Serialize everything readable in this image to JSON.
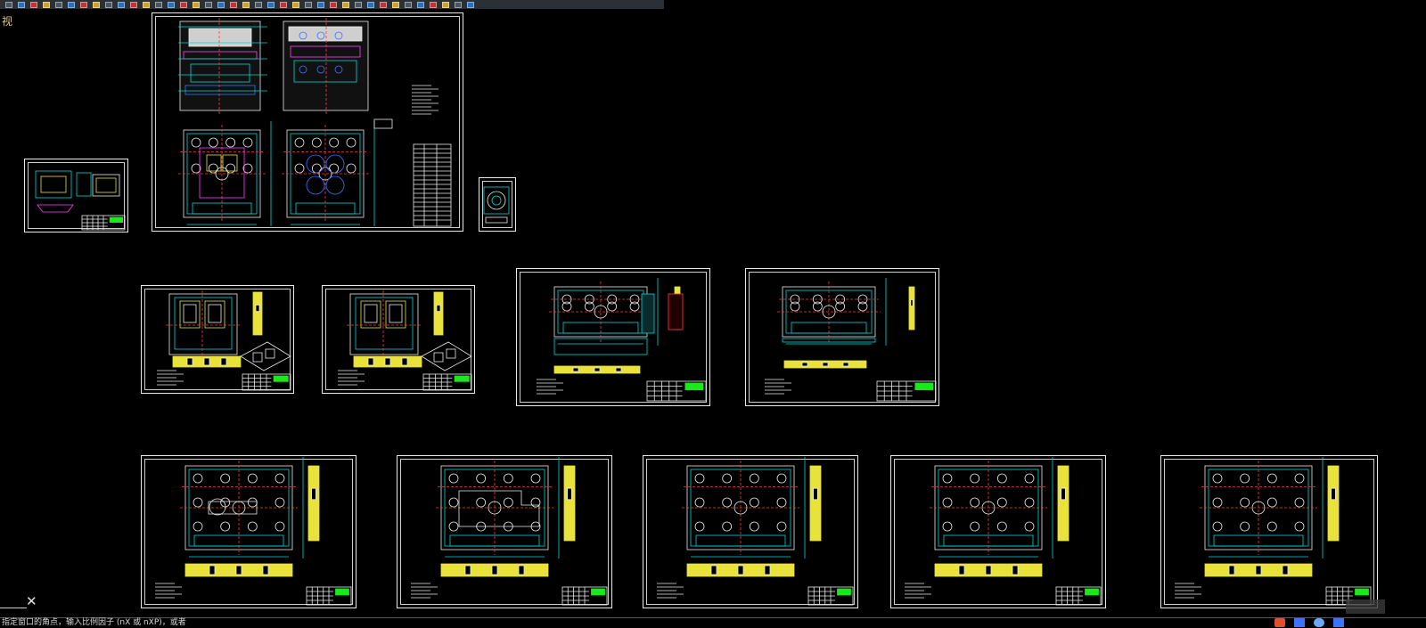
{
  "app": {
    "view_label": "视",
    "command_prompt": "指定窗口的角点，输入比例因子 (nX 或 nXP)，或者",
    "close_glyph": "✕"
  },
  "toolbar": {
    "icons": [
      "new-icon",
      "open-icon",
      "save-icon",
      "saveas-icon",
      "plot-icon",
      "undo-icon",
      "redo-icon",
      "pan-icon",
      "zoom-icon",
      "layer-icon",
      "properties-icon",
      "match-icon",
      "line-icon",
      "polyline-icon",
      "circle-icon",
      "arc-icon",
      "rectangle-icon",
      "hatch-icon",
      "text-icon",
      "dimension-icon",
      "block-icon",
      "insert-icon",
      "copy-icon",
      "move-icon",
      "rotate-icon",
      "scale-icon",
      "trim-icon",
      "extend-icon",
      "offset-icon",
      "mirror-icon",
      "array-icon",
      "fillet-icon",
      "chamfer-icon",
      "explode-icon",
      "erase-icon",
      "measure-icon",
      "layout-icon",
      "help-icon"
    ]
  },
  "colors": {
    "background": "#000000",
    "sheet_border": "#e9e9e9",
    "cyan": "#00d6d6",
    "yellow": "#e8e23a",
    "red": "#ff3b3b",
    "green": "#19e819",
    "magenta": "#ff40ff",
    "blue": "#3b73ff",
    "white": "#e9e9e9"
  },
  "drawing_sheets": [
    {
      "id": "assembly",
      "kind": "assembly"
    },
    {
      "id": "product",
      "kind": "product"
    },
    {
      "id": "small-part",
      "kind": "small"
    },
    {
      "id": "core-insert",
      "kind": "insert"
    },
    {
      "id": "cavity-insert",
      "kind": "insert"
    },
    {
      "id": "fixed-plate",
      "kind": "plate"
    },
    {
      "id": "moving-plate",
      "kind": "plate"
    },
    {
      "id": "plate-1",
      "kind": "plate-large"
    },
    {
      "id": "plate-2",
      "kind": "plate-large"
    },
    {
      "id": "plate-3",
      "kind": "plate-large"
    },
    {
      "id": "plate-4",
      "kind": "plate-large"
    },
    {
      "id": "plate-5",
      "kind": "plate-large"
    }
  ]
}
